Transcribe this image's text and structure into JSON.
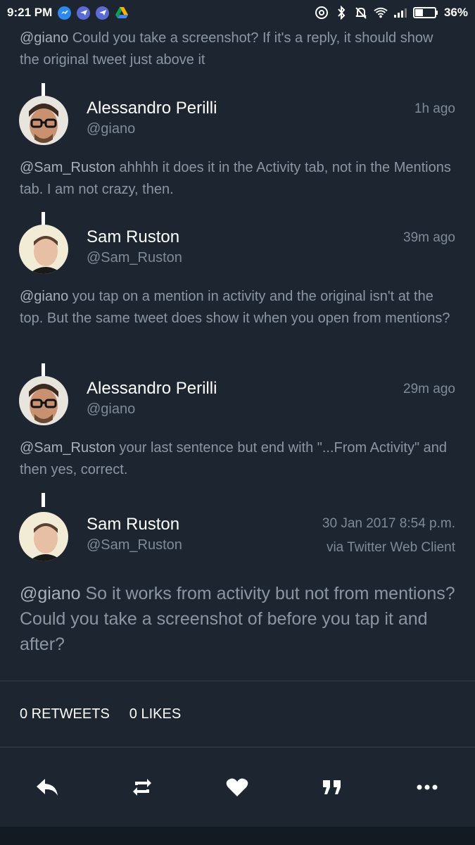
{
  "status_bar": {
    "time": "9:21 PM",
    "battery": "36%",
    "left_icons": [
      "messenger-icon",
      "telegram-icon",
      "telegram-icon",
      "drive-icon"
    ],
    "right_icons": [
      "hotspot-icon",
      "bluetooth-icon",
      "mute-icon",
      "wifi-icon",
      "signal-icon",
      "battery-icon"
    ]
  },
  "thread": [
    {
      "text_mention": "@giano",
      "text_body": " Could you take a screenshot? If it's a reply, it should show the original tweet just above it"
    },
    {
      "name": "Alessandro Perilli",
      "handle": "@giano",
      "time": "1h ago",
      "text_mention": "@Sam_Ruston",
      "text_body": " ahhhh it does it in the Activity tab, not in the Mentions tab. I am not crazy, then."
    },
    {
      "name": "Sam Ruston",
      "handle": "@Sam_Ruston",
      "time": "39m ago",
      "text_mention": "@giano",
      "text_body": " you tap on a mention in activity and the original isn't at the top. But the same tweet does show it when you open from mentions?"
    },
    {
      "name": "Alessandro Perilli",
      "handle": "@giano",
      "time": "29m ago",
      "text_mention": "@Sam_Ruston",
      "text_body": " your last sentence but end with \"...From Activity\" and then yes, correct."
    }
  ],
  "main_tweet": {
    "name": "Sam Ruston",
    "handle": "@Sam_Ruston",
    "date": "30 Jan 2017 8:54 p.m.",
    "via": "via Twitter Web Client",
    "text_mention": "@giano",
    "text_body": " So it works from activity but not from mentions? Could you take a screenshot of before you tap it and after?"
  },
  "stats": {
    "retweets": "0 RETWEETS",
    "likes": "0 LIKES"
  },
  "actions": [
    "reply-icon",
    "retweet-icon",
    "like-icon",
    "quote-icon",
    "more-icon"
  ],
  "colors": {
    "background": "#1c2530",
    "text_dim": "#8c96a3",
    "name": "#ffffff"
  }
}
